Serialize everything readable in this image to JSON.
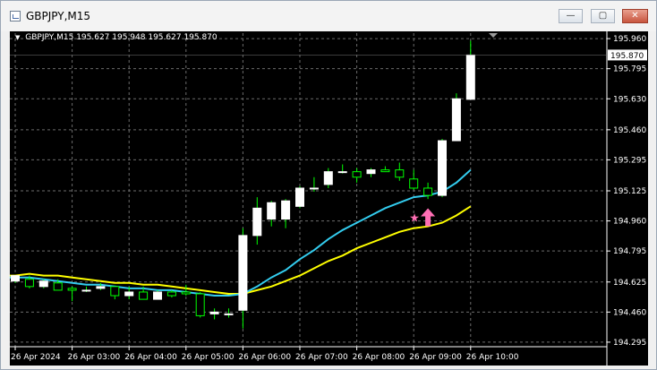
{
  "window": {
    "title": "GBPJPY,M15",
    "buttons": {
      "minimize": "—",
      "maximize": "▢",
      "close": "✕"
    }
  },
  "chart": {
    "symbol_label": "GBPJPY,M15",
    "ohlc_text": "195.627 195.948 195.627 195.870",
    "current_price": "195.870",
    "colors": {
      "background": "#000000",
      "grid": "#6b6b6b",
      "bull_body": "#ffffff",
      "bear_body": "#000000",
      "wick": "#00ff00",
      "ma_fast": "#33ccee",
      "ma_slow": "#ffff00",
      "marker": "#ff6eb4"
    }
  },
  "chart_data": {
    "type": "candlestick",
    "yaxis_ticks": [
      "195.960",
      "195.795",
      "195.630",
      "195.460",
      "195.295",
      "195.125",
      "194.960",
      "194.795",
      "194.625",
      "194.460",
      "194.295"
    ],
    "xaxis_ticks": [
      "26 Apr 2024",
      "26 Apr 03:00",
      "26 Apr 04:00",
      "26 Apr 05:00",
      "26 Apr 06:00",
      "26 Apr 07:00",
      "26 Apr 08:00",
      "26 Apr 09:00",
      "26 Apr 10:00"
    ],
    "ylim": [
      194.27,
      195.99
    ],
    "grid": true,
    "candles": [
      {
        "o": 194.63,
        "h": 194.66,
        "l": 194.62,
        "c": 194.66
      },
      {
        "o": 194.64,
        "h": 194.66,
        "l": 194.59,
        "c": 194.6
      },
      {
        "o": 194.6,
        "h": 194.64,
        "l": 194.59,
        "c": 194.63
      },
      {
        "o": 194.62,
        "h": 194.64,
        "l": 194.58,
        "c": 194.58
      },
      {
        "o": 194.59,
        "h": 194.6,
        "l": 194.52,
        "c": 194.58
      },
      {
        "o": 194.58,
        "h": 194.6,
        "l": 194.57,
        "c": 194.58
      },
      {
        "o": 194.59,
        "h": 194.62,
        "l": 194.58,
        "c": 194.6
      },
      {
        "o": 194.6,
        "h": 194.6,
        "l": 194.53,
        "c": 194.55
      },
      {
        "o": 194.55,
        "h": 194.6,
        "l": 194.53,
        "c": 194.57
      },
      {
        "o": 194.57,
        "h": 194.6,
        "l": 194.53,
        "c": 194.53
      },
      {
        "o": 194.53,
        "h": 194.58,
        "l": 194.53,
        "c": 194.57
      },
      {
        "o": 194.57,
        "h": 194.58,
        "l": 194.54,
        "c": 194.55
      },
      {
        "o": 194.57,
        "h": 194.61,
        "l": 194.55,
        "c": 194.56
      },
      {
        "o": 194.56,
        "h": 194.57,
        "l": 194.43,
        "c": 194.44
      },
      {
        "o": 194.45,
        "h": 194.48,
        "l": 194.42,
        "c": 194.46
      },
      {
        "o": 194.45,
        "h": 194.48,
        "l": 194.43,
        "c": 194.45
      },
      {
        "o": 194.47,
        "h": 194.92,
        "l": 194.37,
        "c": 194.88
      },
      {
        "o": 194.88,
        "h": 195.09,
        "l": 194.83,
        "c": 195.03
      },
      {
        "o": 194.97,
        "h": 195.07,
        "l": 194.93,
        "c": 195.06
      },
      {
        "o": 194.97,
        "h": 195.08,
        "l": 194.92,
        "c": 195.07
      },
      {
        "o": 195.04,
        "h": 195.15,
        "l": 195.03,
        "c": 195.14
      },
      {
        "o": 195.14,
        "h": 195.2,
        "l": 195.12,
        "c": 195.14
      },
      {
        "o": 195.16,
        "h": 195.25,
        "l": 195.14,
        "c": 195.23
      },
      {
        "o": 195.23,
        "h": 195.27,
        "l": 195.22,
        "c": 195.23
      },
      {
        "o": 195.23,
        "h": 195.25,
        "l": 195.17,
        "c": 195.2
      },
      {
        "o": 195.22,
        "h": 195.25,
        "l": 195.2,
        "c": 195.24
      },
      {
        "o": 195.24,
        "h": 195.26,
        "l": 195.23,
        "c": 195.23
      },
      {
        "o": 195.24,
        "h": 195.28,
        "l": 195.18,
        "c": 195.2
      },
      {
        "o": 195.19,
        "h": 195.24,
        "l": 195.13,
        "c": 195.14
      },
      {
        "o": 195.14,
        "h": 195.17,
        "l": 195.08,
        "c": 195.1
      },
      {
        "o": 195.1,
        "h": 195.41,
        "l": 195.09,
        "c": 195.4
      },
      {
        "o": 195.4,
        "h": 195.66,
        "l": 195.4,
        "c": 195.63
      },
      {
        "o": 195.627,
        "h": 195.948,
        "l": 195.627,
        "c": 195.87
      }
    ],
    "ma_fast": [
      194.65,
      194.65,
      194.64,
      194.63,
      194.62,
      194.61,
      194.61,
      194.6,
      194.59,
      194.59,
      194.58,
      194.58,
      194.57,
      194.56,
      194.55,
      194.55,
      194.56,
      194.6,
      194.65,
      194.69,
      194.75,
      194.8,
      194.86,
      194.91,
      194.95,
      194.99,
      195.03,
      195.06,
      195.09,
      195.1,
      195.12,
      195.17,
      195.24
    ],
    "ma_slow": [
      194.66,
      194.67,
      194.66,
      194.66,
      194.65,
      194.64,
      194.63,
      194.62,
      194.62,
      194.61,
      194.61,
      194.6,
      194.59,
      194.58,
      194.57,
      194.56,
      194.56,
      194.58,
      194.6,
      194.63,
      194.66,
      194.7,
      194.74,
      194.77,
      194.81,
      194.84,
      194.87,
      194.9,
      194.92,
      194.93,
      194.95,
      194.99,
      195.04
    ],
    "signals": [
      {
        "index": 28,
        "type": "star",
        "price": 194.98
      },
      {
        "index": 29,
        "type": "arrow-up",
        "price": 194.97
      }
    ]
  }
}
